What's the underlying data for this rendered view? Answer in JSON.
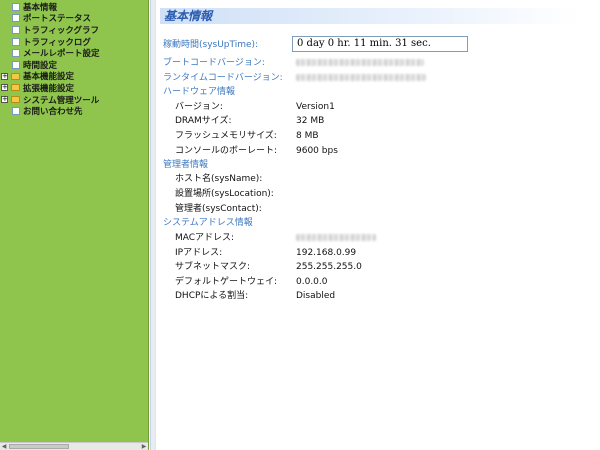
{
  "sidebar": {
    "items": [
      {
        "label": "基本情報",
        "type": "page",
        "expandable": false
      },
      {
        "label": "ポートステータス",
        "type": "page",
        "expandable": false
      },
      {
        "label": "トラフィックグラフ",
        "type": "page",
        "expandable": false
      },
      {
        "label": "トラフィックログ",
        "type": "page",
        "expandable": false
      },
      {
        "label": "メールレポート設定",
        "type": "page",
        "expandable": false
      },
      {
        "label": "時間設定",
        "type": "page",
        "expandable": false
      },
      {
        "label": "基本機能設定",
        "type": "folder",
        "expandable": true
      },
      {
        "label": "拡張機能設定",
        "type": "folder",
        "expandable": true
      },
      {
        "label": "システム管理ツール",
        "type": "folder",
        "expandable": true
      },
      {
        "label": "お問い合わせ先",
        "type": "page",
        "expandable": false
      }
    ],
    "expand_symbol": "+",
    "scroll_left": "◀",
    "scroll_right": "▶",
    "bg_color": "#8fc54c"
  },
  "main": {
    "title": "基本情報",
    "uptime": {
      "label": "稼動時間(sysUpTime):",
      "value": "0 day  0 hr.  11 min.  31 sec."
    },
    "boot_code_version": {
      "label": "ブートコードバージョン:"
    },
    "runtime_code_version": {
      "label": "ランタイムコードバージョン:"
    },
    "hardware": {
      "section": "ハードウェア情報",
      "version": {
        "label": "バージョン:",
        "value": "Version1"
      },
      "dram": {
        "label": "DRAMサイズ:",
        "value": "32 MB"
      },
      "flash": {
        "label": "フラッシュメモリサイズ:",
        "value": "8 MB"
      },
      "console": {
        "label": "コンソールのボーレート:",
        "value": "9600 bps"
      }
    },
    "admin": {
      "section": "管理者情報",
      "host": {
        "label": "ホスト名(sysName):"
      },
      "location": {
        "label": "設置場所(sysLocation):"
      },
      "contact": {
        "label": "管理者(sysContact):"
      }
    },
    "sysaddr": {
      "section": "システムアドレス情報",
      "mac": {
        "label": "MACアドレス:"
      },
      "ip": {
        "label": "IPアドレス:",
        "value": "192.168.0.99"
      },
      "subnet": {
        "label": "サブネットマスク:",
        "value": "255.255.255.0"
      },
      "gateway": {
        "label": "デフォルトゲートウェイ:",
        "value": "0.0.0.0"
      },
      "dhcp": {
        "label": "DHCPによる割当:",
        "value": "Disabled"
      }
    },
    "accent_color": "#3c78c0"
  }
}
